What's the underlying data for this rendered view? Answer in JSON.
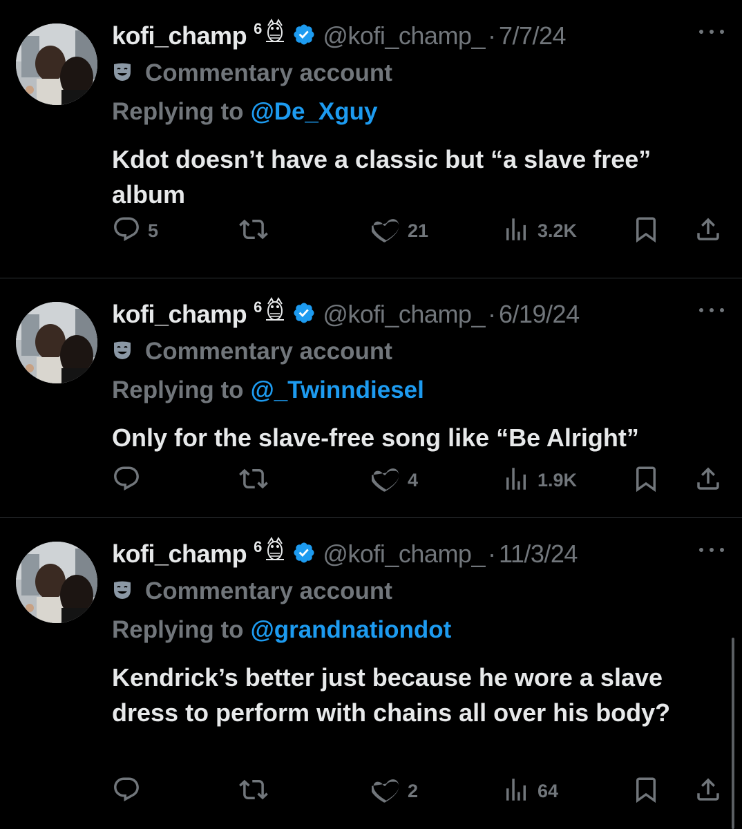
{
  "colors": {
    "background": "#000000",
    "text": "#e7e9ea",
    "muted": "#71767b",
    "link": "#1d9bf0",
    "verified": "#1d9bf0"
  },
  "tweets": [
    {
      "name": "kofi_champ",
      "superscript": "6",
      "handle": "@kofi_champ_",
      "separator": "·",
      "date": "7/7/24",
      "label": "Commentary account",
      "reply_prefix": "Replying to",
      "reply_to": "@De_Xguy",
      "text": "Kdot doesn’t have a classic but “a slave free” album",
      "replies": "5",
      "retweets": "",
      "likes": "21",
      "views": "3.2K"
    },
    {
      "name": "kofi_champ",
      "superscript": "6",
      "handle": "@kofi_champ_",
      "separator": "·",
      "date": "6/19/24",
      "label": "Commentary account",
      "reply_prefix": "Replying to",
      "reply_to": "@_Twinndiesel",
      "text": "Only for the slave-free song like “Be Alright”",
      "replies": "",
      "retweets": "",
      "likes": "4",
      "views": "1.9K"
    },
    {
      "name": "kofi_champ",
      "superscript": "6",
      "handle": "@kofi_champ_",
      "separator": "·",
      "date": "11/3/24",
      "label": "Commentary account",
      "reply_prefix": "Replying to",
      "reply_to": "@grandnationdot",
      "text": "Kendrick’s better just because he wore a slave dress to perform with chains all over his body?",
      "replies": "",
      "retweets": "",
      "likes": "2",
      "views": "64"
    }
  ]
}
